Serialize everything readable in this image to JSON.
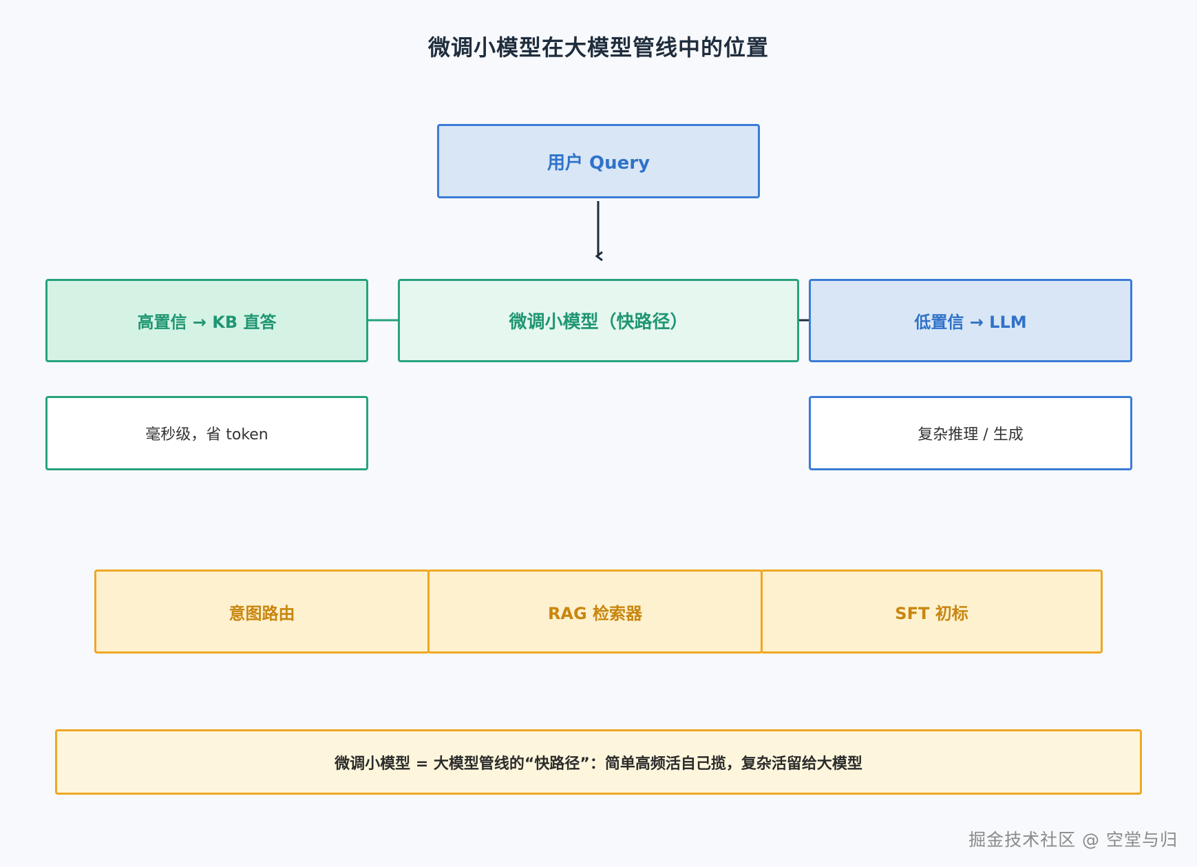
{
  "title": "微调小模型在大模型管线中的位置",
  "nodes": {
    "query": "用户 Query",
    "high_conf": "高置信 → KB 直答",
    "small_model": "微调小模型（快路径）",
    "low_conf": "低置信 → LLM",
    "high_conf_note": "毫秒级，省 token",
    "low_conf_note": "复杂推理 / 生成"
  },
  "use_cases": [
    "意图路由",
    "RAG 检索器",
    "SFT 初标"
  ],
  "summary": "微调小模型 = 大模型管线的“快路径”：简单高频活自己揽，复杂活留给大模型",
  "watermark": "掘金技术社区 @ 空堂与归",
  "colors": {
    "blue": "#3a7bd5",
    "green": "#27a27c",
    "yellow": "#efa722",
    "dark": "#1f2d3d"
  }
}
